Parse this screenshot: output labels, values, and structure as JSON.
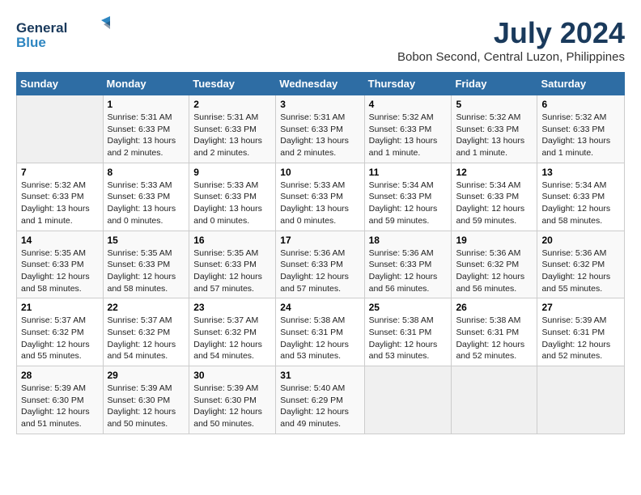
{
  "header": {
    "logo_general": "General",
    "logo_blue": "Blue",
    "month": "July 2024",
    "location": "Bobon Second, Central Luzon, Philippines"
  },
  "weekdays": [
    "Sunday",
    "Monday",
    "Tuesday",
    "Wednesday",
    "Thursday",
    "Friday",
    "Saturday"
  ],
  "weeks": [
    [
      {
        "day": "",
        "sunrise": "",
        "sunset": "",
        "daylight": ""
      },
      {
        "day": "1",
        "sunrise": "Sunrise: 5:31 AM",
        "sunset": "Sunset: 6:33 PM",
        "daylight": "Daylight: 13 hours and 2 minutes."
      },
      {
        "day": "2",
        "sunrise": "Sunrise: 5:31 AM",
        "sunset": "Sunset: 6:33 PM",
        "daylight": "Daylight: 13 hours and 2 minutes."
      },
      {
        "day": "3",
        "sunrise": "Sunrise: 5:31 AM",
        "sunset": "Sunset: 6:33 PM",
        "daylight": "Daylight: 13 hours and 2 minutes."
      },
      {
        "day": "4",
        "sunrise": "Sunrise: 5:32 AM",
        "sunset": "Sunset: 6:33 PM",
        "daylight": "Daylight: 13 hours and 1 minute."
      },
      {
        "day": "5",
        "sunrise": "Sunrise: 5:32 AM",
        "sunset": "Sunset: 6:33 PM",
        "daylight": "Daylight: 13 hours and 1 minute."
      },
      {
        "day": "6",
        "sunrise": "Sunrise: 5:32 AM",
        "sunset": "Sunset: 6:33 PM",
        "daylight": "Daylight: 13 hours and 1 minute."
      }
    ],
    [
      {
        "day": "7",
        "sunrise": "Sunrise: 5:32 AM",
        "sunset": "Sunset: 6:33 PM",
        "daylight": "Daylight: 13 hours and 1 minute."
      },
      {
        "day": "8",
        "sunrise": "Sunrise: 5:33 AM",
        "sunset": "Sunset: 6:33 PM",
        "daylight": "Daylight: 13 hours and 0 minutes."
      },
      {
        "day": "9",
        "sunrise": "Sunrise: 5:33 AM",
        "sunset": "Sunset: 6:33 PM",
        "daylight": "Daylight: 13 hours and 0 minutes."
      },
      {
        "day": "10",
        "sunrise": "Sunrise: 5:33 AM",
        "sunset": "Sunset: 6:33 PM",
        "daylight": "Daylight: 13 hours and 0 minutes."
      },
      {
        "day": "11",
        "sunrise": "Sunrise: 5:34 AM",
        "sunset": "Sunset: 6:33 PM",
        "daylight": "Daylight: 12 hours and 59 minutes."
      },
      {
        "day": "12",
        "sunrise": "Sunrise: 5:34 AM",
        "sunset": "Sunset: 6:33 PM",
        "daylight": "Daylight: 12 hours and 59 minutes."
      },
      {
        "day": "13",
        "sunrise": "Sunrise: 5:34 AM",
        "sunset": "Sunset: 6:33 PM",
        "daylight": "Daylight: 12 hours and 58 minutes."
      }
    ],
    [
      {
        "day": "14",
        "sunrise": "Sunrise: 5:35 AM",
        "sunset": "Sunset: 6:33 PM",
        "daylight": "Daylight: 12 hours and 58 minutes."
      },
      {
        "day": "15",
        "sunrise": "Sunrise: 5:35 AM",
        "sunset": "Sunset: 6:33 PM",
        "daylight": "Daylight: 12 hours and 58 minutes."
      },
      {
        "day": "16",
        "sunrise": "Sunrise: 5:35 AM",
        "sunset": "Sunset: 6:33 PM",
        "daylight": "Daylight: 12 hours and 57 minutes."
      },
      {
        "day": "17",
        "sunrise": "Sunrise: 5:36 AM",
        "sunset": "Sunset: 6:33 PM",
        "daylight": "Daylight: 12 hours and 57 minutes."
      },
      {
        "day": "18",
        "sunrise": "Sunrise: 5:36 AM",
        "sunset": "Sunset: 6:33 PM",
        "daylight": "Daylight: 12 hours and 56 minutes."
      },
      {
        "day": "19",
        "sunrise": "Sunrise: 5:36 AM",
        "sunset": "Sunset: 6:32 PM",
        "daylight": "Daylight: 12 hours and 56 minutes."
      },
      {
        "day": "20",
        "sunrise": "Sunrise: 5:36 AM",
        "sunset": "Sunset: 6:32 PM",
        "daylight": "Daylight: 12 hours and 55 minutes."
      }
    ],
    [
      {
        "day": "21",
        "sunrise": "Sunrise: 5:37 AM",
        "sunset": "Sunset: 6:32 PM",
        "daylight": "Daylight: 12 hours and 55 minutes."
      },
      {
        "day": "22",
        "sunrise": "Sunrise: 5:37 AM",
        "sunset": "Sunset: 6:32 PM",
        "daylight": "Daylight: 12 hours and 54 minutes."
      },
      {
        "day": "23",
        "sunrise": "Sunrise: 5:37 AM",
        "sunset": "Sunset: 6:32 PM",
        "daylight": "Daylight: 12 hours and 54 minutes."
      },
      {
        "day": "24",
        "sunrise": "Sunrise: 5:38 AM",
        "sunset": "Sunset: 6:31 PM",
        "daylight": "Daylight: 12 hours and 53 minutes."
      },
      {
        "day": "25",
        "sunrise": "Sunrise: 5:38 AM",
        "sunset": "Sunset: 6:31 PM",
        "daylight": "Daylight: 12 hours and 53 minutes."
      },
      {
        "day": "26",
        "sunrise": "Sunrise: 5:38 AM",
        "sunset": "Sunset: 6:31 PM",
        "daylight": "Daylight: 12 hours and 52 minutes."
      },
      {
        "day": "27",
        "sunrise": "Sunrise: 5:39 AM",
        "sunset": "Sunset: 6:31 PM",
        "daylight": "Daylight: 12 hours and 52 minutes."
      }
    ],
    [
      {
        "day": "28",
        "sunrise": "Sunrise: 5:39 AM",
        "sunset": "Sunset: 6:30 PM",
        "daylight": "Daylight: 12 hours and 51 minutes."
      },
      {
        "day": "29",
        "sunrise": "Sunrise: 5:39 AM",
        "sunset": "Sunset: 6:30 PM",
        "daylight": "Daylight: 12 hours and 50 minutes."
      },
      {
        "day": "30",
        "sunrise": "Sunrise: 5:39 AM",
        "sunset": "Sunset: 6:30 PM",
        "daylight": "Daylight: 12 hours and 50 minutes."
      },
      {
        "day": "31",
        "sunrise": "Sunrise: 5:40 AM",
        "sunset": "Sunset: 6:29 PM",
        "daylight": "Daylight: 12 hours and 49 minutes."
      },
      {
        "day": "",
        "sunrise": "",
        "sunset": "",
        "daylight": ""
      },
      {
        "day": "",
        "sunrise": "",
        "sunset": "",
        "daylight": ""
      },
      {
        "day": "",
        "sunrise": "",
        "sunset": "",
        "daylight": ""
      }
    ]
  ]
}
